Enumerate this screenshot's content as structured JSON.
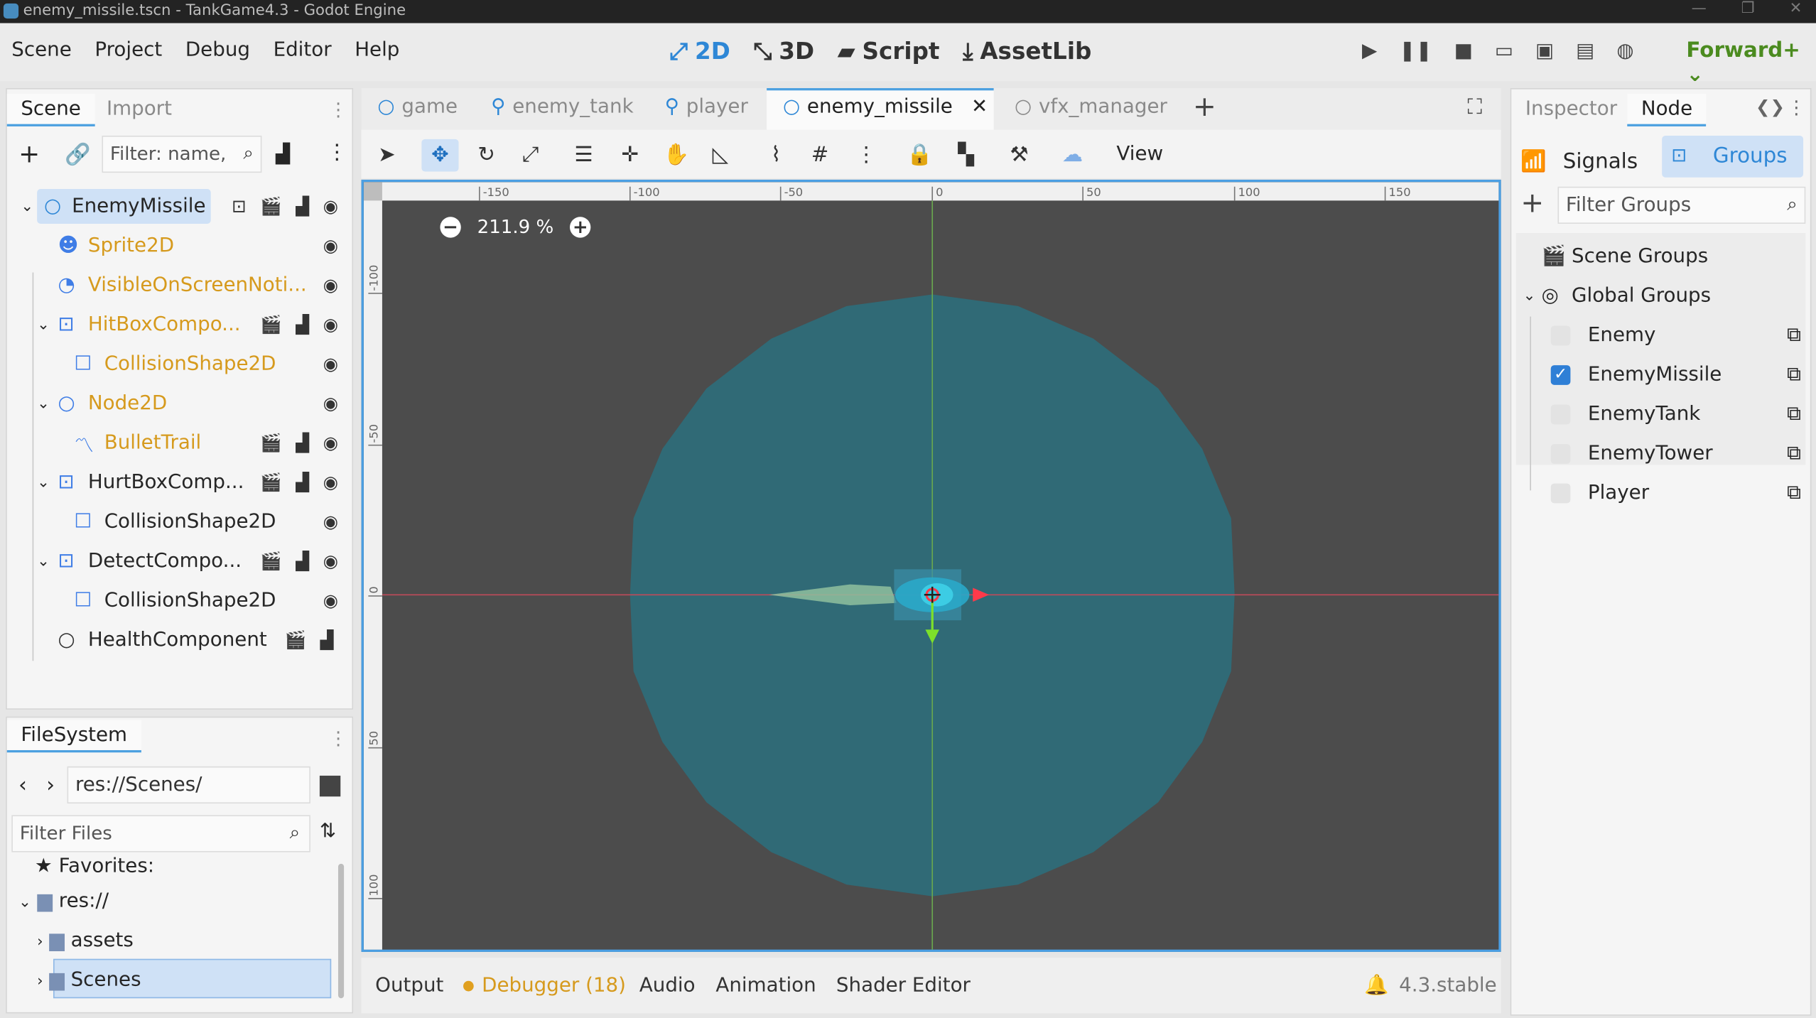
{
  "window": {
    "title": "enemy_missile.tscn - TankGame4.3 - Godot Engine"
  },
  "menus": [
    "Scene",
    "Project",
    "Debug",
    "Editor",
    "Help"
  ],
  "workspaces": [
    {
      "label": "2D",
      "icon": "2d-icon",
      "active": true
    },
    {
      "label": "3D",
      "icon": "3d-icon",
      "active": false
    },
    {
      "label": "Script",
      "icon": "script-icon",
      "active": false
    },
    {
      "label": "AssetLib",
      "icon": "assetlib-icon",
      "active": false
    }
  ],
  "renderer": "Forward+",
  "scene_dock": {
    "tabs": [
      "Scene",
      "Import"
    ],
    "filter_placeholder": "Filter: name,",
    "nodes": [
      {
        "label": "EnemyMissile",
        "type": "root"
      },
      {
        "label": "Sprite2D"
      },
      {
        "label": "VisibleOnScreenNoti..."
      },
      {
        "label": "HitBoxCompo..."
      },
      {
        "label": "CollisionShape2D"
      },
      {
        "label": "Node2D"
      },
      {
        "label": "BulletTrail"
      },
      {
        "label": "HurtBoxComp..."
      },
      {
        "label": "CollisionShape2D"
      },
      {
        "label": "DetectCompo..."
      },
      {
        "label": "CollisionShape2D"
      },
      {
        "label": "HealthComponent"
      }
    ]
  },
  "filesystem": {
    "tab": "FileSystem",
    "path": "res://Scenes/",
    "filter_placeholder": "Filter Files",
    "items": [
      "Favorites:",
      "res://",
      "assets",
      "Scenes"
    ]
  },
  "editor_tabs": [
    "game",
    "enemy_tank",
    "player",
    "enemy_missile",
    "vfx_manager"
  ],
  "toolbar": {
    "view_label": "View"
  },
  "viewport": {
    "zoom": "211.9 %",
    "ruler_h": [
      "-150",
      "-100",
      "-50",
      "0",
      "50",
      "100",
      "150"
    ],
    "ruler_v": [
      "-100",
      "-50",
      "0",
      "50",
      "100"
    ]
  },
  "bottom_panel": {
    "tabs": [
      "Output",
      "Debugger (18)",
      "Audio",
      "Animation",
      "Shader Editor"
    ],
    "version": "4.3.stable"
  },
  "inspector": {
    "tabs": [
      "Inspector",
      "Node"
    ],
    "subtabs": [
      "Signals",
      "Groups"
    ],
    "filter_placeholder": "Filter Groups",
    "sections": [
      "Scene Groups",
      "Global Groups"
    ],
    "groups": [
      {
        "name": "Enemy",
        "checked": false
      },
      {
        "name": "EnemyMissile",
        "checked": true
      },
      {
        "name": "EnemyTank",
        "checked": false
      },
      {
        "name": "EnemyTower",
        "checked": false
      },
      {
        "name": "Player",
        "checked": false
      }
    ]
  },
  "colors": {
    "accent": "#4ba0e0",
    "node_warning": "#d69a1d",
    "renderer": "#4b8b1f",
    "viewport_bg": "#4c4c4c",
    "circle_fill": "#2e6b78"
  }
}
